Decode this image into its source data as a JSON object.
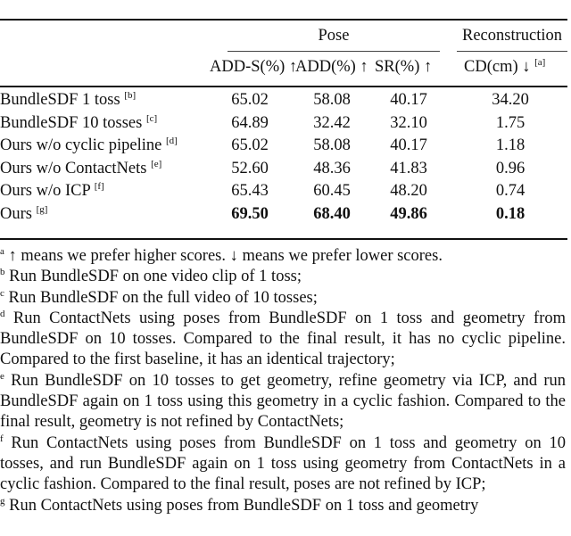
{
  "table": {
    "group_headers": [
      "Pose",
      "Reconstruction"
    ],
    "columns": [
      "ADD-S(%) ↑",
      "ADD(%) ↑",
      "SR(%) ↑",
      "CD(cm) ↓"
    ],
    "column_note": "[a]",
    "rows": [
      {
        "method": "BundleSDF 1 toss",
        "note": "[b]",
        "values": [
          "65.02",
          "58.08",
          "40.17",
          "34.20"
        ],
        "bold": false
      },
      {
        "method": "BundleSDF 10 tosses",
        "note": "[c]",
        "values": [
          "64.89",
          "32.42",
          "32.10",
          "1.75"
        ],
        "bold": false
      },
      {
        "method": "Ours w/o cyclic pipeline",
        "note": "[d]",
        "values": [
          "65.02",
          "58.08",
          "40.17",
          "1.18"
        ],
        "bold": false
      },
      {
        "method": "Ours w/o ContactNets",
        "note": "[e]",
        "values": [
          "52.60",
          "48.36",
          "41.83",
          "0.96"
        ],
        "bold": false
      },
      {
        "method": "Ours w/o ICP",
        "note": "[f]",
        "values": [
          "65.43",
          "60.45",
          "48.20",
          "0.74"
        ],
        "bold": false
      },
      {
        "method": "Ours",
        "note": "[g]",
        "values": [
          "69.50",
          "68.40",
          "49.86",
          "0.18"
        ],
        "bold": true
      }
    ]
  },
  "footnotes": [
    {
      "mark": "a",
      "text": "↑ means we prefer higher scores. ↓ means we prefer lower scores."
    },
    {
      "mark": "b",
      "text": "Run BundleSDF on one video clip of 1 toss;"
    },
    {
      "mark": "c",
      "text": "Run BundleSDF on the full video of 10 tosses;"
    },
    {
      "mark": "d",
      "text": "Run ContactNets using poses from BundleSDF on 1 toss and geometry from BundleSDF on 10 tosses. Compared to the final result, it has no cyclic pipeline. Compared to the first baseline, it has an identical trajectory;"
    },
    {
      "mark": "e",
      "text": "Run BundleSDF on 10 tosses to get geometry, refine geometry via ICP, and run BundleSDF again on 1 toss using this geometry in a cyclic fashion. Compared to the final result, geometry is not refined by ContactNets;"
    },
    {
      "mark": "f",
      "text": "Run ContactNets using poses from BundleSDF on 1 toss and geometry on 10 tosses, and run BundleSDF again on 1 toss using geometry from ContactNets in a cyclic fashion. Compared to the final result, poses are not refined by ICP;"
    },
    {
      "mark": "g",
      "text": "Run ContactNets using poses from BundleSDF on 1 toss and geometry"
    }
  ]
}
